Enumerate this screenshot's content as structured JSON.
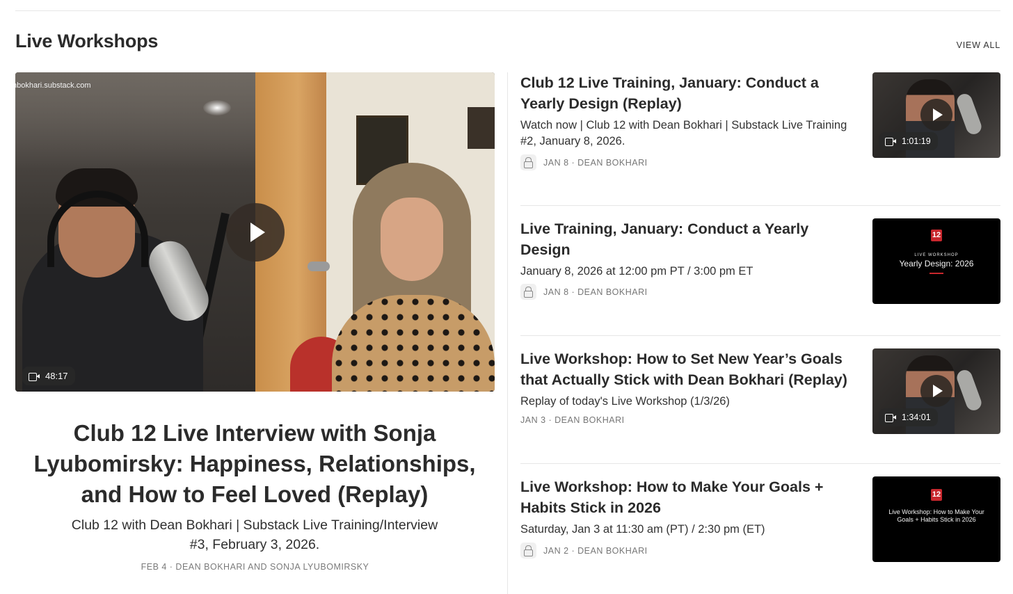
{
  "section": {
    "title": "Live Workshops",
    "view_all": "VIEW ALL"
  },
  "featured": {
    "watermark": "nbokhari.substack.com",
    "duration": "48:17",
    "title": "Club 12 Live Interview with Sonja Lyubomirsky: Happiness, Relationships, and How to Feel Loved (Replay)",
    "subtitle": "Club 12 with Dean Bokhari | Substack Live Training/Interview #3, February 3, 2026.",
    "meta": "FEB 4 · DEAN BOKHARI AND SONJA LYUBOMIRSKY"
  },
  "posts": [
    {
      "title": "Club 12 Live Training, January: Conduct a Yearly Design (Replay)",
      "subtitle": "Watch now | Club 12 with Dean Bokhari | Substack Live Training #2, January 8, 2026.",
      "meta": "JAN 8 · DEAN BOKHARI",
      "locked": true,
      "thumb_duration": "1:01:19"
    },
    {
      "title": "Live Training, January: Conduct a Yearly Design",
      "subtitle": "January 8, 2026 at 12:00 pm PT / 3:00 pm ET",
      "meta": "JAN 8 · DEAN BOKHARI",
      "locked": true,
      "thumb_logo": "12",
      "thumb_kicker": "LIVE WORKSHOP",
      "thumb_heading": "Yearly Design: 2026"
    },
    {
      "title": "Live Workshop: How to Set New Year’s Goals that Actually Stick with Dean Bokhari (Replay)",
      "subtitle": "Replay of today's Live Workshop (1/3/26)",
      "meta": "JAN 3 · DEAN BOKHARI",
      "locked": false,
      "thumb_duration": "1:34:01"
    },
    {
      "title": "Live Workshop: How to Make Your Goals + Habits Stick in 2026",
      "subtitle": "Saturday, Jan 3 at 11:30 am (PT) / 2:30 pm (ET)",
      "meta": "JAN 2 · DEAN BOKHARI",
      "locked": true,
      "thumb_logo": "12",
      "thumb_heading": "Live Workshop: How to Make Your Goals + Habits Stick in 2026"
    }
  ],
  "colors": {
    "logo_red": "#c8272d",
    "text": "#2b2b2b",
    "meta": "#767676"
  }
}
